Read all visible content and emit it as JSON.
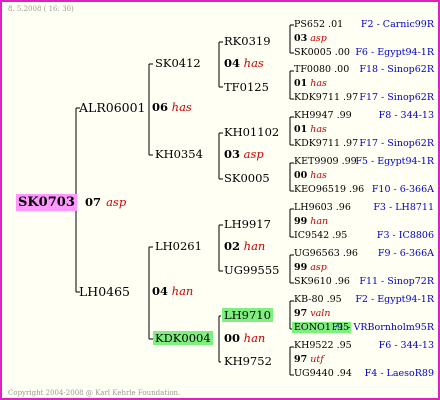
{
  "header": {
    "date": "8. 5.2008 ( 16: 30)"
  },
  "footer": {
    "copyright": "Copyright 2004-2008 @ Karl Kehrle Foundation."
  },
  "root": {
    "name": "SK0703",
    "year": "07",
    "code": "asp"
  },
  "gen1": [
    {
      "name": "ALR06001",
      "year": "06",
      "code": "has"
    },
    {
      "name": "LH0465",
      "year": "04",
      "code": "han"
    }
  ],
  "gen2": [
    {
      "name": "SK0412"
    },
    {
      "name": "KH0354"
    },
    {
      "name": "LH0261"
    },
    {
      "name": "KDK0004"
    }
  ],
  "gen3": [
    {
      "name": "RK0319",
      "year": "04",
      "code": "has"
    },
    {
      "name": "TF0125"
    },
    {
      "name": "KH01102",
      "year": "03",
      "code": "asp"
    },
    {
      "name": "SK0005",
      "year": "00",
      "code": ""
    },
    {
      "name": "LH9917",
      "year": "02",
      "code": "han"
    },
    {
      "name": "UG99555"
    },
    {
      "name": "LH9710",
      "year": "00",
      "code": "han"
    },
    {
      "name": "KH9752"
    }
  ],
  "gen4": [
    {
      "queen": "PS652 .01",
      "year": "03",
      "code": "asp",
      "drone": "SK0005 .00",
      "ql": "F2 - Carnic99R",
      "dl": "F6 - Egypt94-1R"
    },
    {
      "queen": "TF0080 .00",
      "year": "01",
      "code": "has",
      "drone": "KDK9711 .97",
      "ql": "F18 - Sinop62R",
      "dl": "F17 - Sinop62R"
    },
    {
      "queen": "KH9947 .99",
      "year": "01",
      "code": "has",
      "drone": "KDK9711 .97",
      "ql": "F8 - 344-13",
      "dl": "F17 - Sinop62R"
    },
    {
      "queen": "KET9909 .99",
      "year": "00",
      "code": "has",
      "drone": "KEO96519 .96",
      "ql": "F5 - Egypt94-1R",
      "dl": "F10 - 6-366A"
    },
    {
      "queen": "LH9603 .96",
      "year": "99",
      "code": "han",
      "drone": "IC9542 .95",
      "ql": "F3 - LH8711",
      "dl": "F3 - IC8806"
    },
    {
      "queen": "UG96563 .96",
      "year": "99",
      "code": "asp",
      "drone": "SK9610 .96",
      "ql": "F9 - 6-366A",
      "dl": "F11 - Sinop72R"
    },
    {
      "queen": "KB-80 .95",
      "year": "97",
      "code": "valn",
      "drone": "EONO1 .95",
      "ql": "F2 - Egypt94-1R",
      "dl": "F1 - VRBornholm95R"
    },
    {
      "queen": "KH9522 .95",
      "year": "97",
      "code": "utf",
      "drone": "UG9440 .94",
      "ql": "F6 - 344-13",
      "dl": "F4 - LaesoR89"
    }
  ]
}
